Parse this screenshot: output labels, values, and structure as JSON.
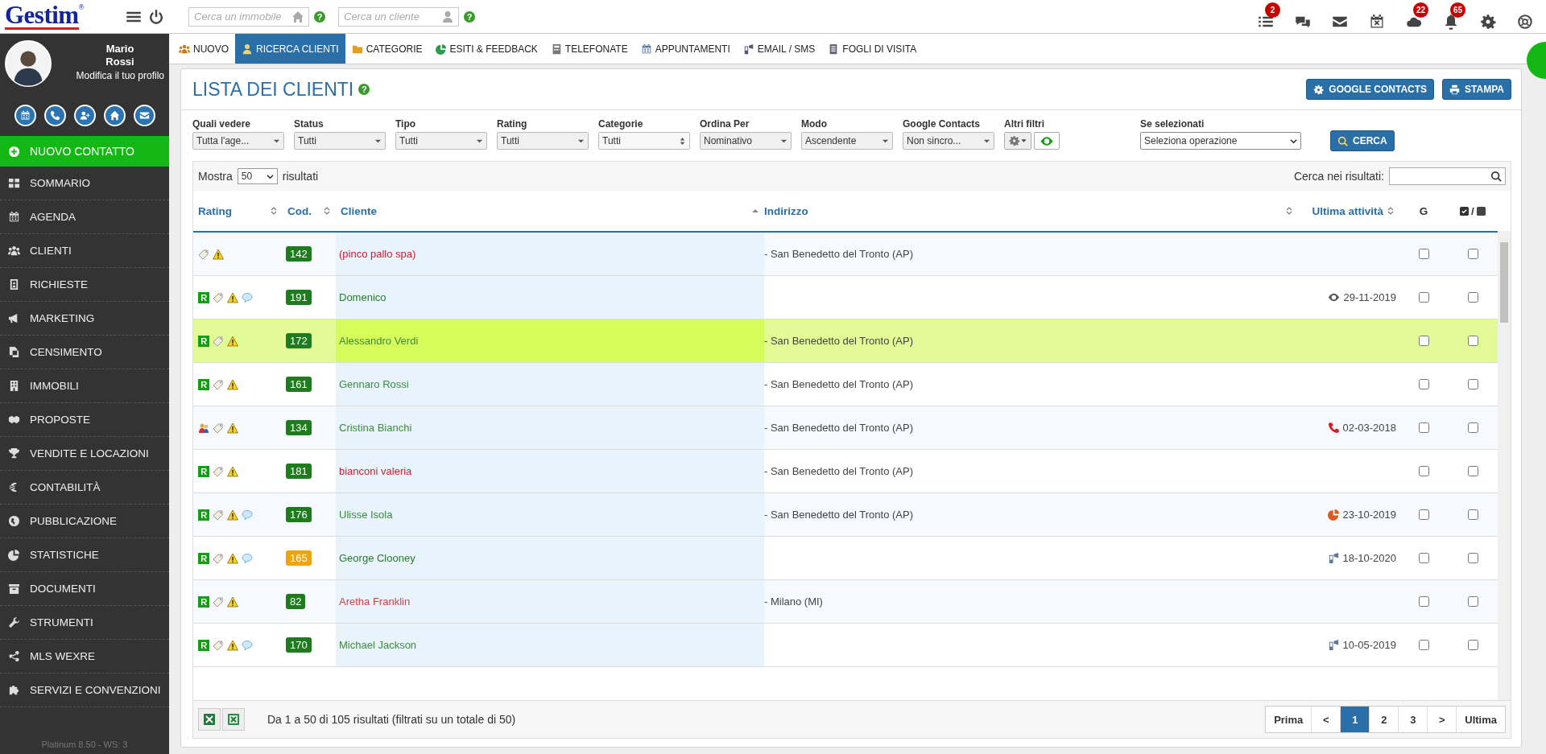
{
  "logo": {
    "text": "Gestim",
    "mark": "®"
  },
  "top_search": [
    {
      "placeholder": "Cerca un immobile",
      "help": "?"
    },
    {
      "placeholder": "Cerca un cliente",
      "help": "?"
    }
  ],
  "top_icons": [
    {
      "kind": "list",
      "badge": "2"
    },
    {
      "kind": "chat"
    },
    {
      "kind": "mail"
    },
    {
      "kind": "calendar"
    },
    {
      "kind": "cloud",
      "badge": "22"
    },
    {
      "kind": "bell",
      "badge": "65"
    },
    {
      "kind": "gear"
    },
    {
      "kind": "lifebuoy"
    }
  ],
  "profile": {
    "first_name": "Mario",
    "last_name": "Rossi",
    "edit_link": "Modifica il tuo profilo"
  },
  "new_contact": "NUOVO CONTATTO",
  "sidebar": {
    "items": [
      {
        "label": "SOMMARIO"
      },
      {
        "label": "AGENDA"
      },
      {
        "label": "CLIENTI"
      },
      {
        "label": "RICHIESTE"
      },
      {
        "label": "MARKETING"
      },
      {
        "label": "CENSIMENTO"
      },
      {
        "label": "IMMOBILI"
      },
      {
        "label": "PROPOSTE"
      },
      {
        "label": "VENDITE E LOCAZIONI"
      },
      {
        "label": "CONTABILITÀ"
      },
      {
        "label": "PUBBLICAZIONE"
      },
      {
        "label": "STATISTICHE"
      },
      {
        "label": "DOCUMENTI"
      },
      {
        "label": "STRUMENTI"
      },
      {
        "label": "MLS WEXRE"
      },
      {
        "label": "SERVIZI E CONVENZIONI"
      }
    ],
    "footer": "Platinum 8.50 - WS: 3"
  },
  "tabs": [
    {
      "label": "NUOVO",
      "selected": false
    },
    {
      "label": "RICERCA CLIENTI",
      "selected": true
    },
    {
      "label": "CATEGORIE",
      "selected": false
    },
    {
      "label": "ESITI & FEEDBACK",
      "selected": false
    },
    {
      "label": "TELEFONATE",
      "selected": false
    },
    {
      "label": "APPUNTAMENTI",
      "selected": false
    },
    {
      "label": "EMAIL / SMS",
      "selected": false
    },
    {
      "label": "FOGLI DI VISITA",
      "selected": false
    }
  ],
  "panel": {
    "title": "LISTA DEI CLIENTI",
    "help": "?",
    "buttons": [
      "GOOGLE CONTACTS",
      "STAMPA"
    ]
  },
  "filters": [
    {
      "label": "Quali vedere",
      "value": "Tutta l'age...",
      "kind": "select"
    },
    {
      "label": "Status",
      "value": "Tutti",
      "kind": "select"
    },
    {
      "label": "Tipo",
      "value": "Tutti",
      "kind": "select"
    },
    {
      "label": "Rating",
      "value": "Tutti",
      "kind": "select"
    },
    {
      "label": "Categorie",
      "value": "Tutti",
      "kind": "listbox"
    },
    {
      "label": "Ordina Per",
      "value": "Nominativo",
      "kind": "select"
    },
    {
      "label": "Modo",
      "value": "Ascendente",
      "kind": "select"
    },
    {
      "label": "Google Contacts",
      "value": "Non sincro...",
      "kind": "select"
    }
  ],
  "other_filters": {
    "label": "Altri filtri"
  },
  "bulk": {
    "label": "Se selezionati",
    "value": "Seleziona operazione"
  },
  "search_button": "CERCA",
  "table": {
    "show_label": "Mostra",
    "page_size": "50",
    "results_label": "risultati",
    "search_label": "Cerca nei risultati:",
    "columns": [
      {
        "label": "Rating",
        "sortable": true,
        "sorted": false
      },
      {
        "label": "Cod.",
        "sortable": true,
        "sorted": false
      },
      {
        "label": "Cliente",
        "sortable": true,
        "sorted": true
      },
      {
        "label": "Indirizzo",
        "sortable": true,
        "sorted": false
      },
      {
        "label": "Ultima attività",
        "sortable": true,
        "sorted": false
      },
      {
        "label": "G",
        "sortable": false
      },
      {
        "label": "/",
        "sortable": false
      }
    ],
    "rows": [
      {
        "r_badge": false,
        "people": false,
        "feedback": false,
        "code": {
          "text": "142",
          "color": "#1e7b1e"
        },
        "name": {
          "text": "(pinco pallo spa)",
          "color": "#cc1f2d"
        },
        "address": "- San Benedetto del Tronto (AP)",
        "highlighted": false,
        "g_checked": false,
        "checked": false
      },
      {
        "r_badge": true,
        "people": false,
        "feedback": true,
        "code": {
          "text": "191",
          "color": "#1e7b1e"
        },
        "name": {
          "text": "Domenico",
          "color": "#2a7a2a"
        },
        "activity": {
          "kind": "view",
          "date": "29-11-2019"
        },
        "highlighted": false,
        "g_checked": false,
        "checked": false
      },
      {
        "r_badge": true,
        "people": false,
        "feedback": false,
        "code": {
          "text": "172",
          "color": "#1e7b1e"
        },
        "name": {
          "text": "Alessandro Verdi",
          "color": "#3d8b3d"
        },
        "address": "- San Benedetto del Tronto (AP)",
        "highlighted": true,
        "g_checked": false,
        "checked": false
      },
      {
        "r_badge": true,
        "people": false,
        "feedback": false,
        "code": {
          "text": "161",
          "color": "#1e7b1e"
        },
        "name": {
          "text": "Gennaro Rossi",
          "color": "#3d8b3d"
        },
        "address": "- San Benedetto del Tronto (AP)",
        "highlighted": false,
        "g_checked": false,
        "checked": false
      },
      {
        "r_badge": false,
        "people": true,
        "feedback": false,
        "code": {
          "text": "134",
          "color": "#1e7b1e"
        },
        "name": {
          "text": "Cristina Bianchi",
          "color": "#3d8b3d"
        },
        "address": "- San Benedetto del Tronto (AP)",
        "activity": {
          "kind": "call",
          "date": "02-03-2018"
        },
        "highlighted": false,
        "g_checked": false,
        "checked": false
      },
      {
        "r_badge": true,
        "people": false,
        "feedback": false,
        "code": {
          "text": "181",
          "color": "#1e7b1e"
        },
        "name": {
          "text": "bianconi valeria",
          "color": "#cc1f2d"
        },
        "address": "- San Benedetto del Tronto (AP)",
        "highlighted": false,
        "g_checked": false,
        "checked": false
      },
      {
        "r_badge": true,
        "people": false,
        "feedback": true,
        "code": {
          "text": "176",
          "color": "#1e7b1e"
        },
        "name": {
          "text": "Ulisse Isola",
          "color": "#3d8b3d"
        },
        "address": "- San Benedetto del Tronto (AP)",
        "activity": {
          "kind": "feedback",
          "date": "23-10-2019"
        },
        "highlighted": false,
        "g_checked": false,
        "checked": false
      },
      {
        "r_badge": true,
        "people": false,
        "feedback": true,
        "code": {
          "text": "165",
          "color": "#eea40c"
        },
        "name": {
          "text": "George Clooney",
          "color": "#2a7a2a"
        },
        "activity": {
          "kind": "message",
          "date": "18-10-2020"
        },
        "highlighted": false,
        "g_checked": false,
        "checked": false
      },
      {
        "r_badge": true,
        "people": false,
        "feedback": false,
        "code": {
          "text": "82",
          "color": "#1e7b1e"
        },
        "name": {
          "text": "Aretha Franklin",
          "color": "#cc4444"
        },
        "address": "- Milano (MI)",
        "highlighted": false,
        "g_checked": false,
        "checked": false
      },
      {
        "r_badge": true,
        "people": false,
        "feedback": true,
        "code": {
          "text": "170",
          "color": "#1e7b1e"
        },
        "name": {
          "text": "Michael Jackson",
          "color": "#3d8b3d"
        },
        "activity": {
          "kind": "message",
          "date": "10-05-2019"
        },
        "highlighted": false,
        "g_checked": false,
        "checked": false
      }
    ],
    "info": "Da 1 a 50 di 105 risultati (filtrati su un totale di 50)",
    "pages": [
      {
        "label": "Prima",
        "selected": false
      },
      {
        "label": "<",
        "selected": false
      },
      {
        "label": "1",
        "selected": true
      },
      {
        "label": "2",
        "selected": false
      },
      {
        "label": "3",
        "selected": false
      },
      {
        "label": ">",
        "selected": false
      },
      {
        "label": "Ultima",
        "selected": false
      }
    ]
  }
}
